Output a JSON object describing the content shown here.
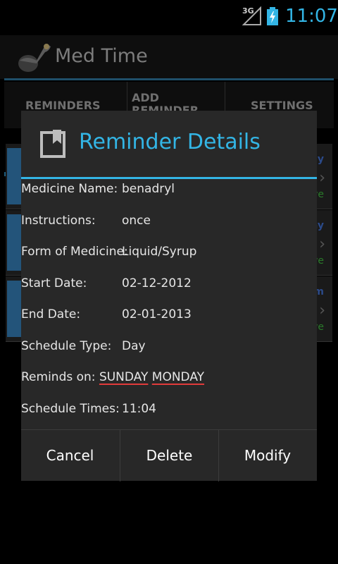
{
  "status_bar": {
    "network": "3G",
    "time": "11:07",
    "icons": [
      "signal-icon",
      "battery-charging-icon"
    ]
  },
  "app": {
    "title": "Med Time",
    "icon": "pill-app-icon",
    "tabs": [
      {
        "label": "REMINDERS",
        "selected": true
      },
      {
        "label": "ADD\nREMINDER",
        "selected": false
      },
      {
        "label": "SETTINGS",
        "selected": false
      }
    ],
    "list_rows": [
      {
        "right_top": "ly",
        "right_bottom": "ve"
      },
      {
        "right_top": "ay",
        "right_bottom": "ve"
      },
      {
        "right_top": "m",
        "right_bottom": "ve"
      }
    ]
  },
  "dialog": {
    "title": "Reminder Details",
    "icon": "bookmark-icon",
    "fields": [
      {
        "label": "Medicine Name:",
        "value": "benadryl"
      },
      {
        "label": "Instructions:",
        "value": "once"
      },
      {
        "label": "Form of Medicine:",
        "value": "Liquid/Syrup"
      },
      {
        "label": "Start Date:",
        "value": "02-12-2012"
      },
      {
        "label": "End Date:",
        "value": "02-01-2013"
      },
      {
        "label": "Schedule Type:",
        "value": "Day"
      }
    ],
    "reminds_on": {
      "label": "Reminds on:",
      "days": [
        "SUNDAY",
        "MONDAY"
      ]
    },
    "schedule_times": {
      "label": "Schedule Times:",
      "value": "11:04"
    },
    "buttons": {
      "cancel": "Cancel",
      "delete": "Delete",
      "modify": "Modify"
    }
  },
  "colors": {
    "accent": "#33b5e5",
    "dialog_bg": "#282828",
    "spellcheck_underline": "#e23b3b"
  }
}
